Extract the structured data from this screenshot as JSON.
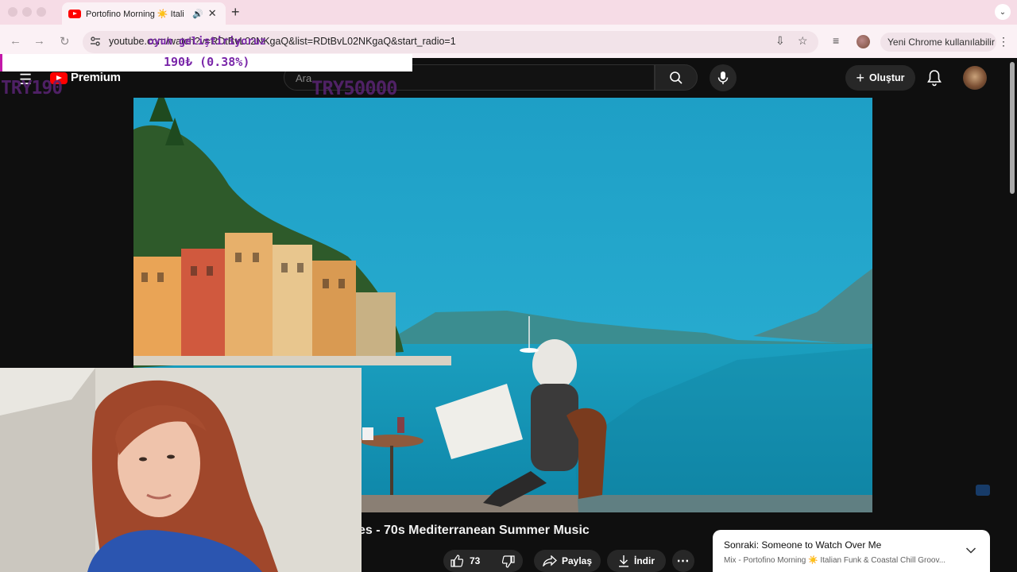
{
  "browser": {
    "tab": {
      "title": "Portofino Morning ☀️ Itali"
    },
    "url": "youtube.com/watch?v=RDtBvL02NKgaQ&list=RDtBvL02NKgaQ&start_radio=1",
    "update_label": "Yeni Chrome kullanılabilir"
  },
  "youtube": {
    "logo_label": "Premium",
    "search_placeholder": "Ara",
    "create_label": "Oluştur"
  },
  "video": {
    "title": "es - 70s Mediterranean Summer Music",
    "likes": "73",
    "share_label": "Paylaş",
    "download_label": "İndir"
  },
  "up_next": {
    "prefix": "Sonraki:",
    "title": "Someone to Watch Over Me",
    "mix": "Mix - Portofino Morning ☀️ Italian Funk & Coastal Chill Groov..."
  },
  "stream_overlay": {
    "donor": "oyun geliştiriyoruz",
    "amount": "190₺ (0.38%)",
    "left_tag": "TRY190",
    "right_tag": "TRY50000"
  },
  "colors": {
    "accent": "#ff0000",
    "overlay": "#7a27a9",
    "chrome_tab": "#f6dce6"
  }
}
